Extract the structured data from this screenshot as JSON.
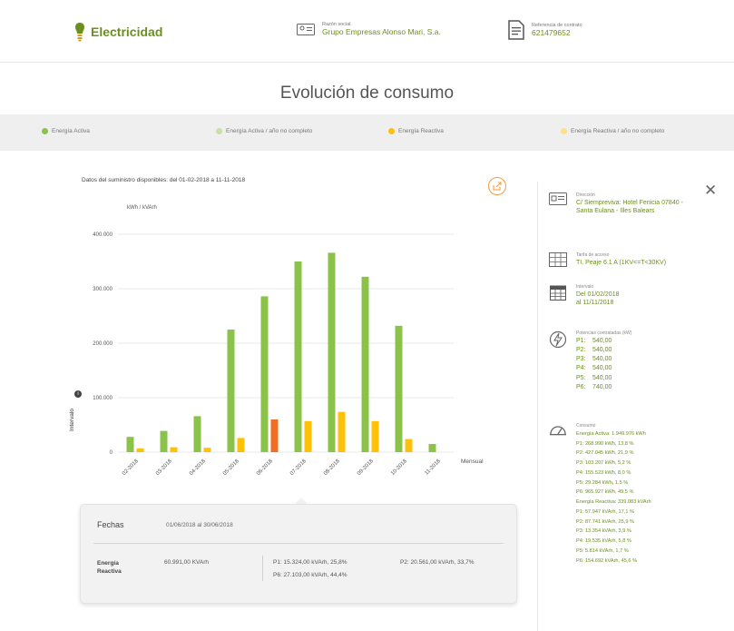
{
  "header": {
    "brand": "Electricidad",
    "razon_label": "Razón social",
    "razon_value": "Grupo Empresas Alonso Mari, S.a.",
    "contrato_label": "Referencia de contrato",
    "contrato_value": "621479652"
  },
  "title": "Evolución de consumo",
  "legend": [
    {
      "label": "Energía Activa",
      "color": "#8bc34a"
    },
    {
      "label": "Energía Activa / año no completo",
      "color": "#c5e1a5"
    },
    {
      "label": "Energía Reactiva",
      "color": "#ffc107"
    },
    {
      "label": "Energía Reactiva / año no completo",
      "color": "#ffe082"
    }
  ],
  "date_range": "Datos del suministro disponibles: del 01-02-2018 a 11-11-2018",
  "unit_label": "kWh / kVArh",
  "y_title": "Intervalo",
  "chart_data": {
    "type": "bar",
    "categories": [
      "02-2018",
      "03-2018",
      "04-2018",
      "05-2018",
      "06-2018",
      "07-2018",
      "08-2018",
      "09-2018",
      "10-2018",
      "11-2018"
    ],
    "series": [
      {
        "name": "Energía Activa",
        "values": [
          28000,
          39000,
          66000,
          225000,
          286000,
          350000,
          366000,
          322000,
          232000,
          15000
        ]
      },
      {
        "name": "Energía Reactiva",
        "values": [
          7000,
          9000,
          8000,
          26000,
          60000,
          57000,
          74000,
          57000,
          24000,
          0
        ]
      }
    ],
    "highlight_index": 4,
    "xlabel": "Mensual",
    "ylim": [
      0,
      400000
    ],
    "yticks": [
      "0",
      "100.000",
      "200.000",
      "300.000",
      "400.000"
    ],
    "ytick_values": [
      0,
      100000,
      200000,
      300000,
      400000
    ],
    "grid": true,
    "colors": {
      "active": "#8bc34a",
      "reactive": "#ffc107",
      "highlight": "#f26d21"
    }
  },
  "popup": {
    "fechas_label": "Fechas",
    "fechas_value": "01/06/2018 al 30/06/2018",
    "row_label_1": "Energía",
    "row_label_2": "Reactiva",
    "total": "60.991,00 KVArh",
    "p1": "P1: 15.324,00 kVArh, 25,8%",
    "p2": "P2: 20.561,00 kVArh, 33,7%",
    "p6": "P6: 27.103,00 kVArh, 44,4%"
  },
  "sidebar": {
    "direccion_label": "Dirección",
    "direccion_value": "C/ Siempreviva: Hotel Fenicia 07840 - Santa Eulana - Illes Balears",
    "tarifa_label": "Tarifa de acceso",
    "tarifa_value": "TI. Peaje 6.1 A (1KV<=T<30KV)",
    "intervalo_label": "Intervalo",
    "intervalo_value_1": "Del 01/02/2018",
    "intervalo_value_2": "al 11/11/2018",
    "potencias_label": "Potencias contratadas (kW)",
    "potencias": [
      {
        "k": "P1:",
        "v": "540,00"
      },
      {
        "k": "P2:",
        "v": "540,00"
      },
      {
        "k": "P3:",
        "v": "540,00"
      },
      {
        "k": "P4:",
        "v": "540,00"
      },
      {
        "k": "P5:",
        "v": "540,00"
      },
      {
        "k": "P6:",
        "v": "740,00"
      }
    ],
    "consumo_label": "Consumo",
    "consumo_lines": [
      "Energía Activa: 1.949.976 kWh",
      "P1: 268.990 kWh, 13,8 %",
      "P2: 427.045 kWh, 21,9 %",
      "P3: 103.207 kWh, 5,2 %",
      "P4: 155.523 kWh, 8,0 %",
      "P5: 29.284 kWh, 1,5 %",
      "P6: 965.927 kWh, 49,5 %",
      "Energía Reactiva: 339.083 kVArh",
      "P1: 57.947 kVArh, 17,1 %",
      "P2: 87.741 kVArh, 25,9 %",
      "P3: 13.354 kVArh, 3,9 %",
      "P4: 19.535 kVArh, 5,8 %",
      "P5: 5.814 kVArh, 1,7 %",
      "P6: 154.692 kVArh, 45,6 %"
    ]
  }
}
